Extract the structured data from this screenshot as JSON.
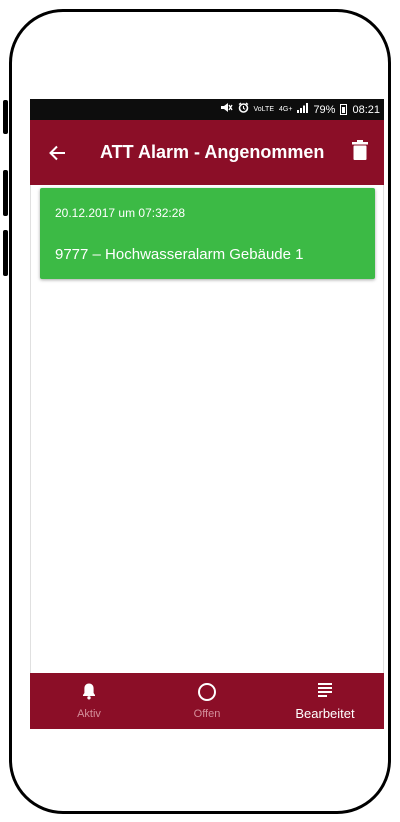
{
  "status_bar": {
    "battery_percent": "79%",
    "time": "08:21",
    "volte_label": "VoLTE",
    "network_label": "4G+"
  },
  "app_bar": {
    "title": "ATT Alarm - Angenommen"
  },
  "alarms": [
    {
      "date": "20.12.2017 um 07:32:28",
      "title": "9777 – Hochwasseralarm Gebäude 1",
      "color": "#3cba45"
    }
  ],
  "bottom_nav": {
    "items": [
      {
        "label": "Aktiv",
        "icon": "bell-icon",
        "active": false
      },
      {
        "label": "Offen",
        "icon": "circle-icon",
        "active": false
      },
      {
        "label": "Bearbeitet",
        "icon": "list-icon",
        "active": true
      }
    ]
  },
  "colors": {
    "primary": "#8b0e27",
    "status_bar": "#0d0d0d",
    "card": "#3cba45",
    "inactive_nav": "#d58f9b"
  }
}
